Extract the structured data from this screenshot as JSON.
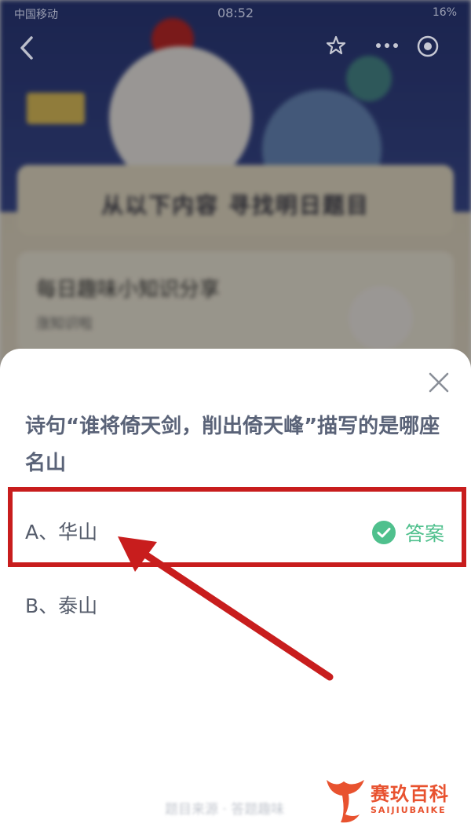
{
  "background": {
    "card_title": "从以下内容 寻找明日题目",
    "item_title": "每日趣味小知识分享",
    "item_subtitle": "涨知识啦"
  },
  "status_bar": {
    "carrier": "中国移动",
    "time": "08:52",
    "battery": "16%"
  },
  "quiz": {
    "question": "诗句“谁将倚天剑，削出倚天峰”描写的是哪座名山",
    "options": [
      {
        "label": "A、华山",
        "is_answer": true
      },
      {
        "label": "B、泰山",
        "is_answer": false
      }
    ],
    "answer_label": "答案",
    "footer": "题目来源 · 答题趣味"
  },
  "watermark": {
    "name": "赛玖百科",
    "pinyin": "SAIJIUBAIKE"
  },
  "colors": {
    "highlight_box": "#c81d1d",
    "answer_green": "#4fc08d",
    "watermark": "#e8522f"
  },
  "icons": [
    "back-icon",
    "star-icon",
    "more-icon",
    "target-icon",
    "close-icon",
    "check-icon",
    "whale-logo-icon"
  ]
}
